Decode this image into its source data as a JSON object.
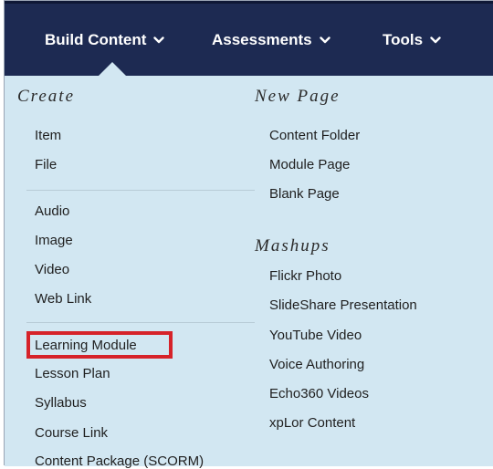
{
  "nav": {
    "tabs": [
      {
        "label": "Build Content"
      },
      {
        "label": "Assessments"
      },
      {
        "label": "Tools"
      }
    ]
  },
  "menu": {
    "create": {
      "heading": "Create",
      "group1": [
        "Item",
        "File"
      ],
      "group2": [
        "Audio",
        "Image",
        "Video",
        "Web Link"
      ],
      "group3": [
        "Learning Module",
        "Lesson Plan",
        "Syllabus",
        "Course Link",
        "Content Package (SCORM)"
      ]
    },
    "new_page": {
      "heading": "New Page",
      "items": [
        "Content Folder",
        "Module Page",
        "Blank Page"
      ]
    },
    "mashups": {
      "heading": "Mashups",
      "items": [
        "Flickr Photo",
        "SlideShare Presentation",
        "YouTube Video",
        "Voice Authoring",
        "Echo360 Videos",
        "xpLor Content"
      ]
    }
  },
  "colors": {
    "topbar": "#1d2a52",
    "panel": "#d2e7f2",
    "highlight": "#d6232a"
  }
}
